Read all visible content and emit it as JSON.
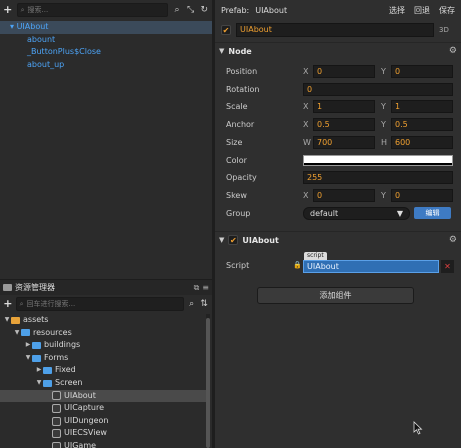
{
  "hierarchy": {
    "search_placeholder": "搜索...",
    "rows": [
      "UIAbout",
      "abount",
      "_ButtonPlus$Close",
      "about_up"
    ]
  },
  "assets": {
    "title": "资源管理器",
    "search_placeholder": "回车进行搜索...",
    "rows": [
      "assets",
      "resources",
      "buildings",
      "Forms",
      "Fixed",
      "Screen",
      "UIAbout",
      "UICapture",
      "UIDungeon",
      "UIECSView",
      "UIGame"
    ]
  },
  "inspector": {
    "prefab_label": "Prefab:",
    "prefab_name": "UIAbout",
    "btn_select": "选择",
    "btn_revert": "回退",
    "btn_save": "保存",
    "node_name": "UIAbout",
    "tag_3d": "3D",
    "node_section": "Node",
    "props": {
      "position": {
        "label": "Position",
        "x": "0",
        "y": "0"
      },
      "rotation": {
        "label": "Rotation",
        "value": "0"
      },
      "scale": {
        "label": "Scale",
        "x": "1",
        "y": "1"
      },
      "anchor": {
        "label": "Anchor",
        "x": "0.5",
        "y": "0.5"
      },
      "size": {
        "label": "Size",
        "w": "700",
        "h": "600"
      },
      "color": {
        "label": "Color",
        "value": "#ffffff"
      },
      "opacity": {
        "label": "Opacity",
        "value": "255"
      },
      "skew": {
        "label": "Skew",
        "x": "0",
        "y": "0"
      },
      "group": {
        "label": "Group",
        "value": "default",
        "edit": "编辑"
      }
    },
    "axis": {
      "x": "X",
      "y": "Y",
      "w": "W",
      "h": "H"
    },
    "component_section": "UIAbout",
    "script_label": "Script",
    "script_tag": "script",
    "script_value": "UIAbout",
    "add_component": "添加组件"
  }
}
